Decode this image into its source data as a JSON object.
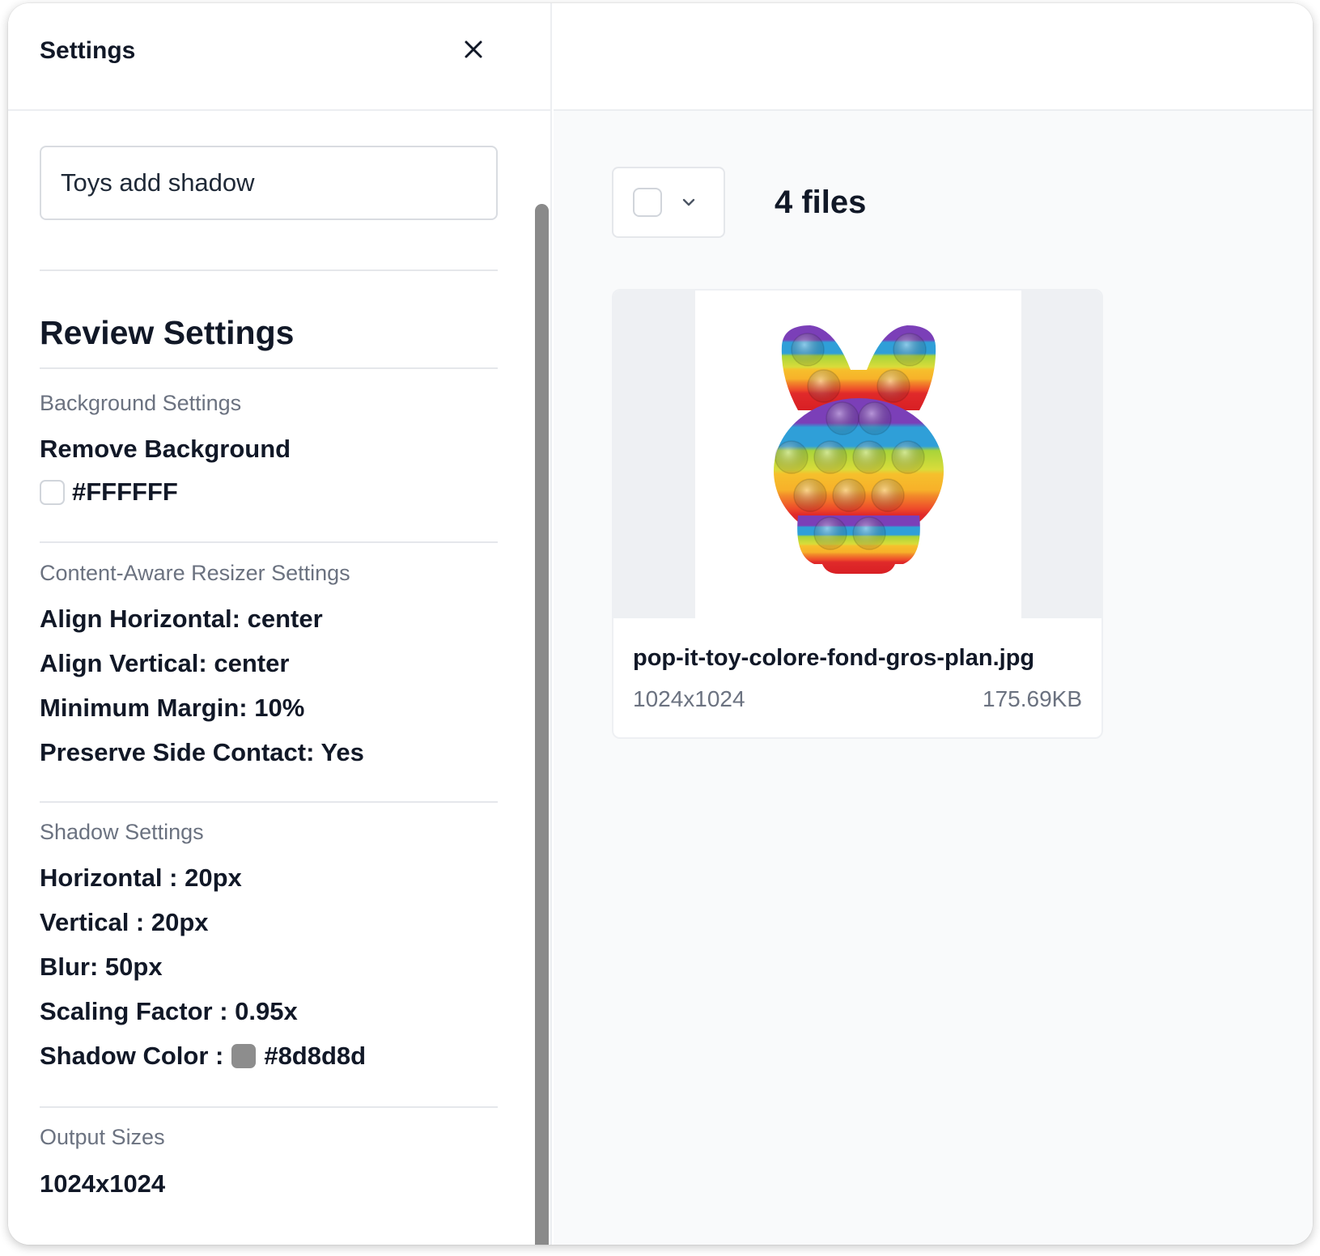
{
  "panel": {
    "title": "Settings",
    "close_icon": "close-icon",
    "name_input_value": "Toys add shadow"
  },
  "review": {
    "title": "Review Settings",
    "background": {
      "label": "Background Settings",
      "remove_background": "Remove Background",
      "color_value": "#FFFFFF"
    },
    "resizer": {
      "label": "Content-Aware Resizer Settings",
      "align_horizontal": "Align Horizontal: center",
      "align_vertical": "Align Vertical: center",
      "minimum_margin": "Minimum Margin: 10%",
      "preserve_side_contact": "Preserve Side Contact: Yes"
    },
    "shadow": {
      "label": "Shadow Settings",
      "horizontal": "Horizontal : 20px",
      "vertical": "Vertical : 20px",
      "blur": "Blur: 50px",
      "scaling_factor": "Scaling Factor : 0.95x",
      "color_label": "Shadow Color :",
      "color_value": "#8d8d8d"
    },
    "output": {
      "label": "Output Sizes",
      "size": "1024x1024"
    }
  },
  "files": {
    "count_label": "4 files",
    "items": [
      {
        "name": "pop-it-toy-colore-fond-gros-plan.jpg",
        "dimensions": "1024x1024",
        "size": "175.69KB"
      }
    ]
  },
  "colors": {
    "shadow_swatch": "#8d8d8d",
    "accent_text": "#111827",
    "muted_text": "#6b7280"
  }
}
